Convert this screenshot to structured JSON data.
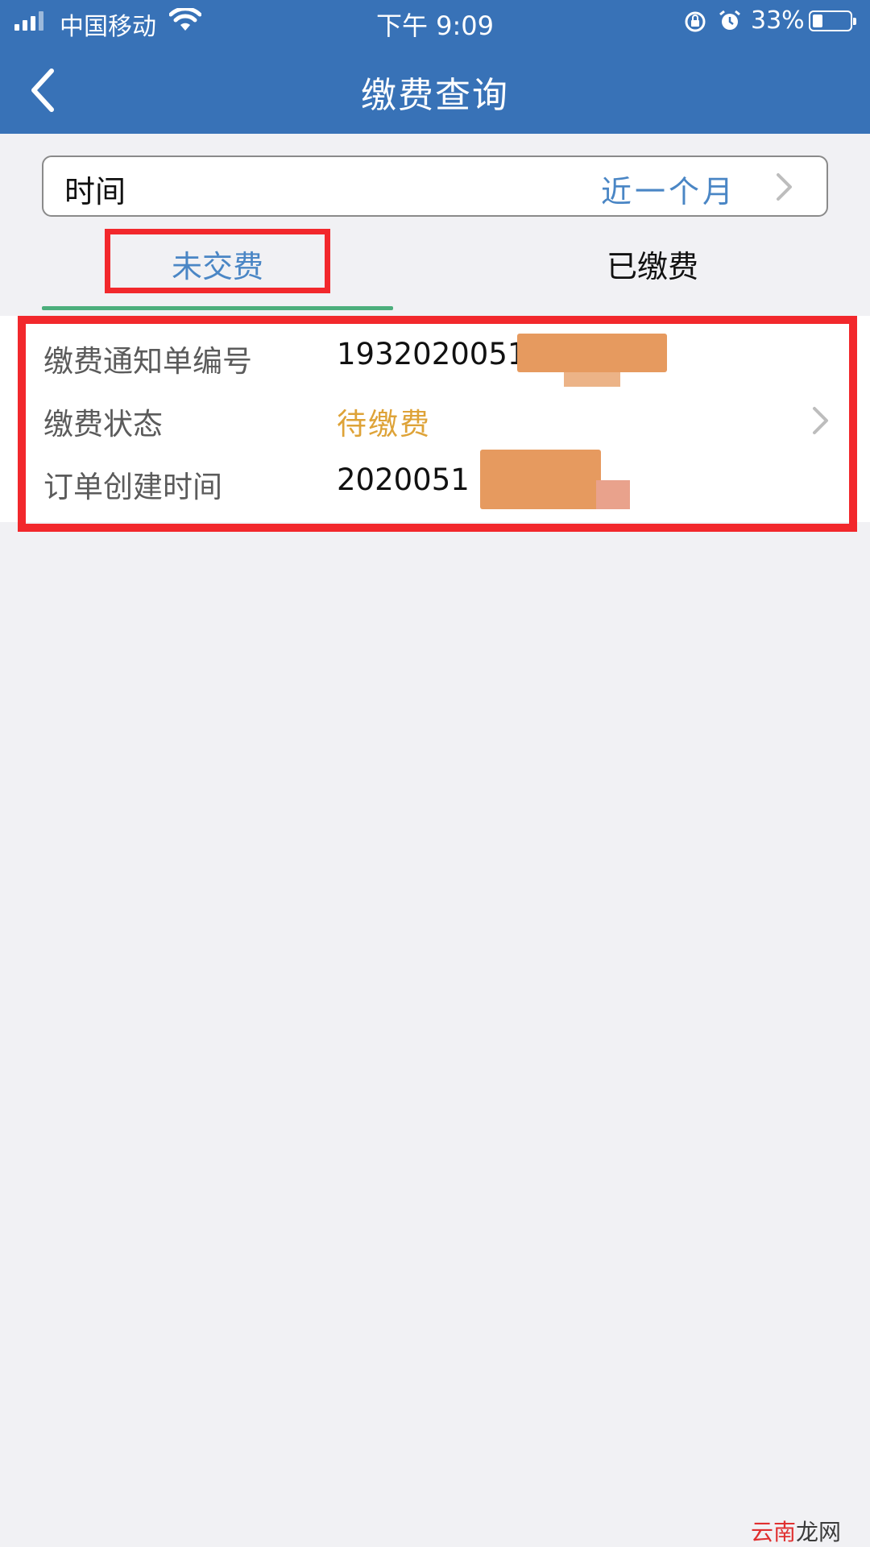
{
  "status_bar": {
    "carrier": "中国移动",
    "time": "下午 9:09",
    "battery_percent": "33%"
  },
  "nav": {
    "title": "缴费查询"
  },
  "filter": {
    "label": "时间",
    "value": "近一个月"
  },
  "tabs": [
    {
      "label": "未交费",
      "active": true
    },
    {
      "label": "已缴费",
      "active": false
    }
  ],
  "record": {
    "fields": [
      {
        "label": "缴费通知单编号",
        "value": "1932020051"
      },
      {
        "label": "缴费状态",
        "value": "待缴费"
      },
      {
        "label": "订单创建时间",
        "value": "2020051"
      }
    ]
  },
  "colors": {
    "nav_bar": "#3872b7",
    "accent_blue": "#4a86c5",
    "tab_underline": "#4cae7c",
    "pending_status": "#dea338",
    "highlight_box": "#f2282c",
    "redaction": "#e69a5f"
  },
  "watermark": {
    "part1": "云南",
    "part2": "龙网"
  }
}
